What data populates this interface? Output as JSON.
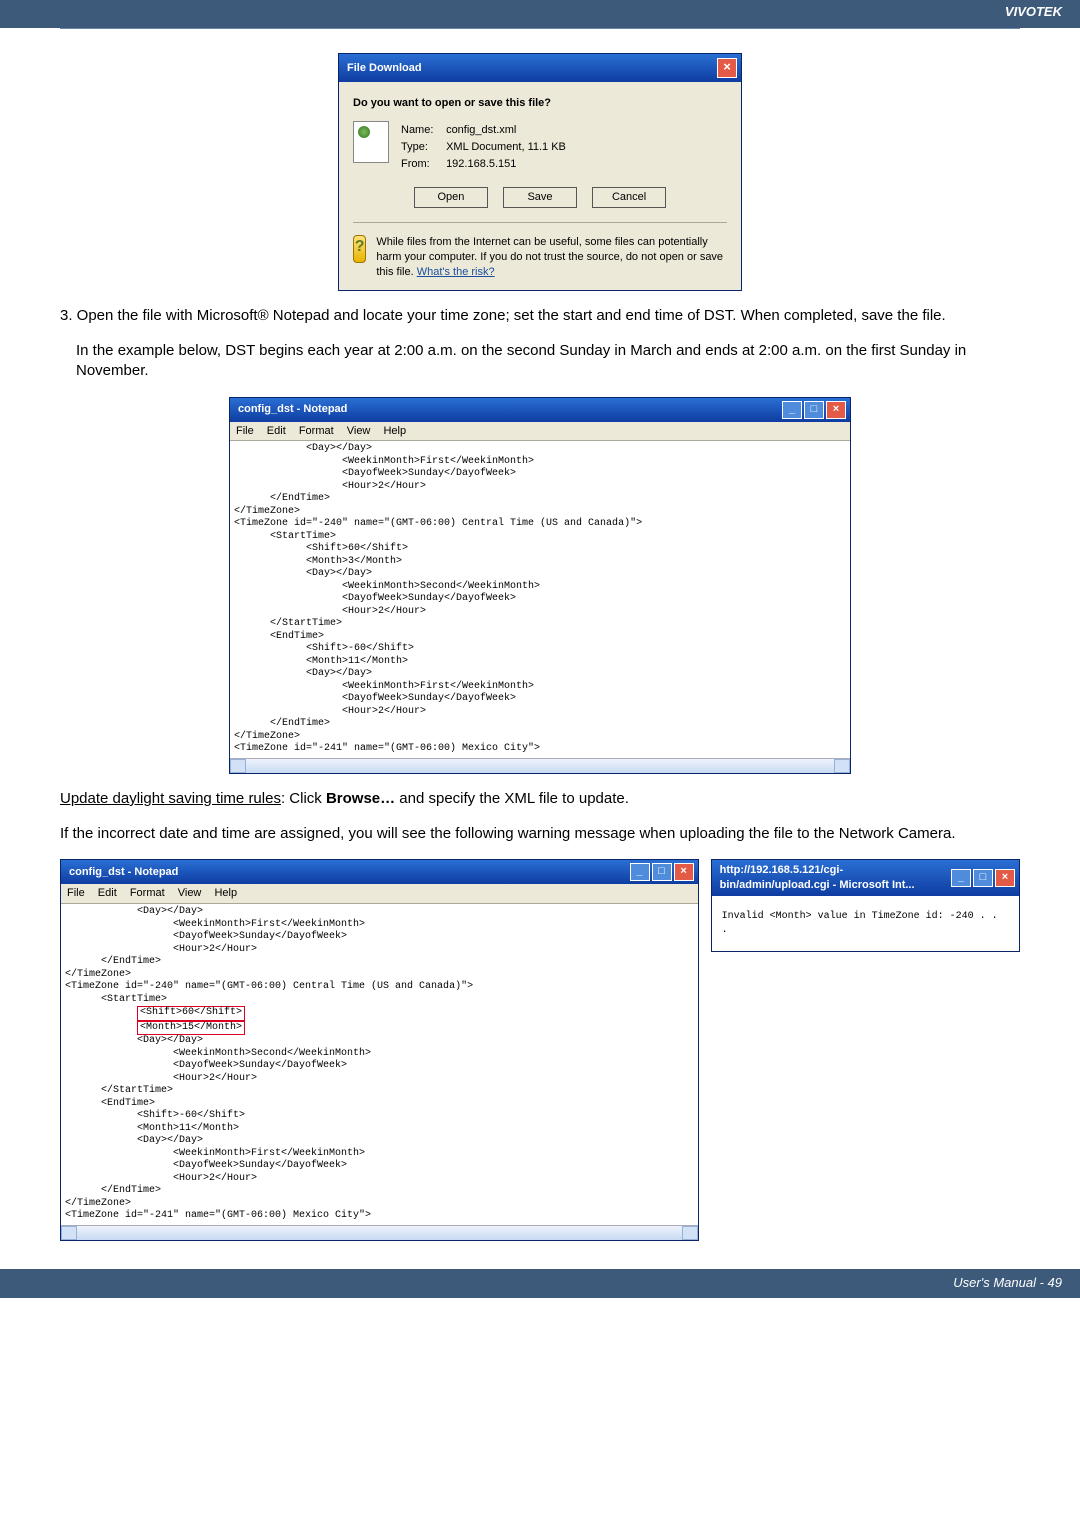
{
  "header": {
    "brand": "VIVOTEK"
  },
  "dialog": {
    "title": "File Download",
    "question": "Do you want to open or save this file?",
    "name_label": "Name:",
    "name_value": "config_dst.xml",
    "type_label": "Type:",
    "type_value": "XML Document, 11.1 KB",
    "from_label": "From:",
    "from_value": "192.168.5.151",
    "btn_open": "Open",
    "btn_save": "Save",
    "btn_cancel": "Cancel",
    "warn_text": "While files from the Internet can be useful, some files can potentially harm your computer. If you do not trust the source, do not open or save this file. ",
    "warn_link": "What's the risk?"
  },
  "para": {
    "step3": "3. Open the file with Microsoft® Notepad and locate your time zone; set the start and end time of DST. When completed, save the file.",
    "example": "In the example below, DST begins each year at 2:00 a.m. on the second Sunday in March and ends at 2:00 a.m. on the first Sunday in November.",
    "update_label": "Update daylight saving time rules",
    "update_rest": ": Click ",
    "browse": "Browse…",
    "update_tail": " and specify the XML file to update.",
    "incorrect": "If the incorrect date and time are assigned, you will see the following warning message when uploading the file to the Network Camera."
  },
  "notepad": {
    "title": "config_dst - Notepad",
    "menu": {
      "file": "File",
      "edit": "Edit",
      "format": "Format",
      "view": "View",
      "help": "Help"
    }
  },
  "xml1": "            <Day></Day>\n                  <WeekinMonth>First</WeekinMonth>\n                  <DayofWeek>Sunday</DayofWeek>\n                  <Hour>2</Hour>\n      </EndTime>\n</TimeZone>\n<TimeZone id=\"-240\" name=\"(GMT-06:00) Central Time (US and Canada)\">\n      <StartTime>\n            <Shift>60</Shift>\n            <Month>3</Month>\n            <Day></Day>\n                  <WeekinMonth>Second</WeekinMonth>\n                  <DayofWeek>Sunday</DayofWeek>\n                  <Hour>2</Hour>\n      </StartTime>\n      <EndTime>\n            <Shift>-60</Shift>\n            <Month>11</Month>\n            <Day></Day>\n                  <WeekinMonth>First</WeekinMonth>\n                  <DayofWeek>Sunday</DayofWeek>\n                  <Hour>2</Hour>\n      </EndTime>\n</TimeZone>\n<TimeZone id=\"-241\" name=\"(GMT-06:00) Mexico City\">",
  "xml2_pre": "            <Day></Day>\n                  <WeekinMonth>First</WeekinMonth>\n                  <DayofWeek>Sunday</DayofWeek>\n                  <Hour>2</Hour>\n      </EndTime>\n</TimeZone>\n<TimeZone id=\"-240\" name=\"(GMT-06:00) Central Time (US and Canada)\">\n      <StartTime>\n            ",
  "xml2_err1": "<Shift>60</Shift>",
  "xml2_err2": "<Month>15</Month>",
  "xml2_mid": "\n            <Day></Day>\n                  <WeekinMonth>Second</WeekinMonth>\n                  <DayofWeek>Sunday</DayofWeek>\n                  <Hour>2</Hour>\n      </StartTime>\n      <EndTime>\n            <Shift>-60</Shift>\n            <Month>11</Month>\n            <Day></Day>\n                  <WeekinMonth>First</WeekinMonth>\n                  <DayofWeek>Sunday</DayofWeek>\n                  <Hour>2</Hour>\n      </EndTime>\n</TimeZone>\n<TimeZone id=\"-241\" name=\"(GMT-06:00) Mexico City\">",
  "ie": {
    "title": "http://192.168.5.121/cgi-bin/admin/upload.cgi - Microsoft Int...",
    "msg": "Invalid <Month> value in TimeZone id: -240 . . ."
  },
  "footer": {
    "text": "User's Manual - 49"
  }
}
